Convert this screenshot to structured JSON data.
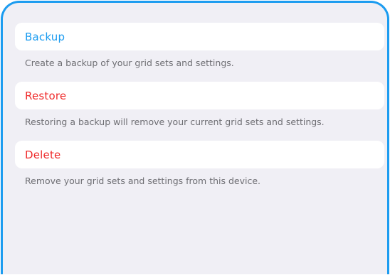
{
  "backup": {
    "label": "Backup",
    "description": "Create a backup of your grid sets and settings.",
    "color": "#1c9cf0"
  },
  "restore": {
    "label": "Restore",
    "description": "Restoring a backup will remove your current grid sets and settings.",
    "color": "#ef2b2b"
  },
  "delete": {
    "label": "Delete",
    "description": "Remove your grid sets and settings from this device.",
    "color": "#ef2b2b"
  },
  "theme": {
    "frame_border": "#1c9cf0",
    "background": "#f0eff5"
  }
}
